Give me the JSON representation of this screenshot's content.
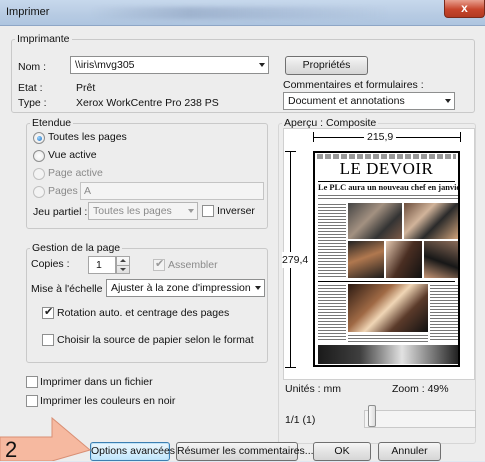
{
  "window": {
    "title": "Imprimer",
    "close_label": "x"
  },
  "printer": {
    "group_label": "Imprimante",
    "name_label": "Nom :",
    "name_value": "\\\\iris\\mvg305",
    "status_label": "Etat :",
    "status_value": "Prêt",
    "type_label": "Type :",
    "type_value": "Xerox WorkCentre Pro 238 PS",
    "properties_button": "Propriétés",
    "comments_label": "Commentaires et formulaires :",
    "comments_value": "Document et annotations"
  },
  "range": {
    "group_label": "Etendue",
    "all_pages": "Toutes les pages",
    "current_view": "Vue active",
    "current_page": "Page active",
    "pages_label": "Pages",
    "pages_value": "A",
    "subset_label": "Jeu partiel :",
    "subset_value": "Toutes les pages",
    "reverse_label": "Inverser"
  },
  "handling": {
    "group_label": "Gestion de la page",
    "copies_label": "Copies :",
    "copies_value": "1",
    "collate_label": "Assembler",
    "scaling_label": "Mise à l'échelle :",
    "scaling_value": "Ajuster à la zone d'impression",
    "auto_rotate_label": "Rotation auto. et centrage des pages",
    "paper_source_label": "Choisir la source de papier selon le format"
  },
  "options": {
    "print_to_file": "Imprimer dans un fichier",
    "print_grayscale": "Imprimer les couleurs en noir"
  },
  "preview": {
    "label": "Aperçu : Composite",
    "width_dim": "215,9",
    "height_dim": "279,4",
    "masthead": "LE DEVOIR",
    "headline": "Le PLC aura un nouveau chef en janvier",
    "units": "Unités : mm",
    "zoom": "Zoom : 49%",
    "page_counter": "1/1 (1)",
    "page_slider_position": 0.0
  },
  "buttons": {
    "advanced": "Options avancées",
    "summarize": "Résumer les commentaires...",
    "ok": "OK",
    "cancel": "Annuler"
  },
  "annotation": {
    "step_number": "2",
    "callout_color": "#f6b9a0"
  }
}
